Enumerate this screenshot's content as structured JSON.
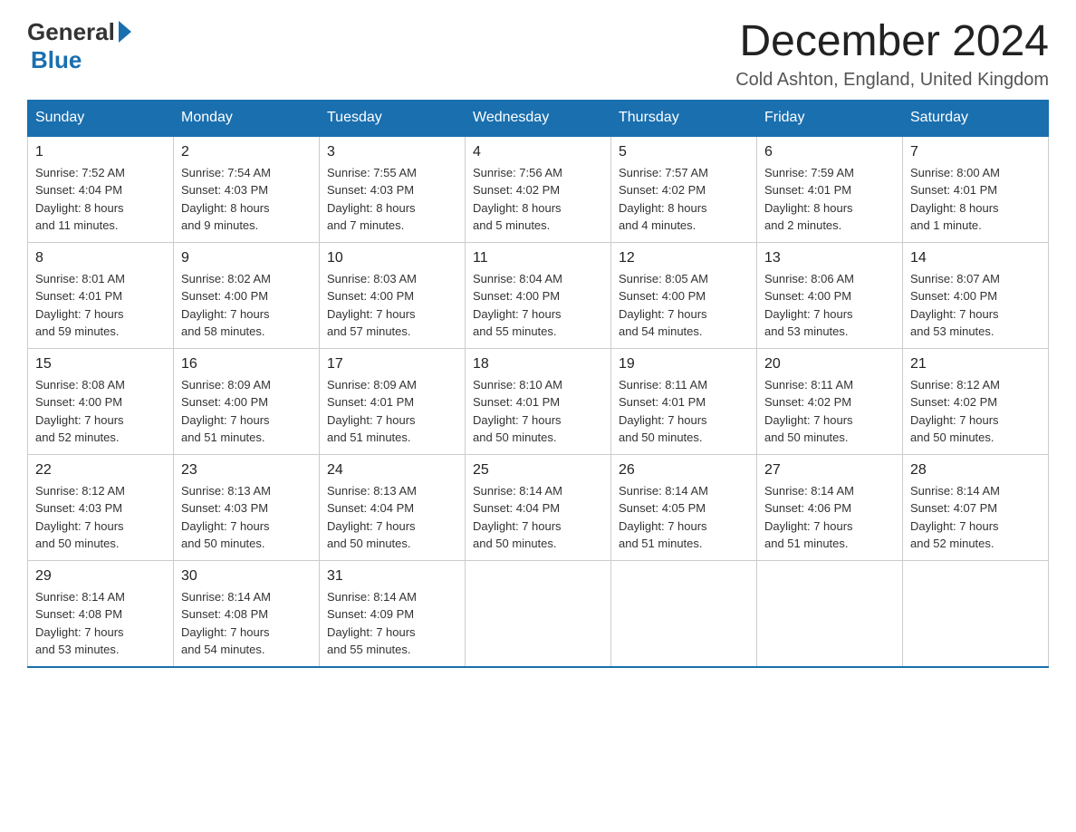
{
  "logo": {
    "text_general": "General",
    "text_blue": "Blue"
  },
  "title": "December 2024",
  "subtitle": "Cold Ashton, England, United Kingdom",
  "days_of_week": [
    "Sunday",
    "Monday",
    "Tuesday",
    "Wednesday",
    "Thursday",
    "Friday",
    "Saturday"
  ],
  "weeks": [
    [
      {
        "day": "1",
        "info": "Sunrise: 7:52 AM\nSunset: 4:04 PM\nDaylight: 8 hours\nand 11 minutes."
      },
      {
        "day": "2",
        "info": "Sunrise: 7:54 AM\nSunset: 4:03 PM\nDaylight: 8 hours\nand 9 minutes."
      },
      {
        "day": "3",
        "info": "Sunrise: 7:55 AM\nSunset: 4:03 PM\nDaylight: 8 hours\nand 7 minutes."
      },
      {
        "day": "4",
        "info": "Sunrise: 7:56 AM\nSunset: 4:02 PM\nDaylight: 8 hours\nand 5 minutes."
      },
      {
        "day": "5",
        "info": "Sunrise: 7:57 AM\nSunset: 4:02 PM\nDaylight: 8 hours\nand 4 minutes."
      },
      {
        "day": "6",
        "info": "Sunrise: 7:59 AM\nSunset: 4:01 PM\nDaylight: 8 hours\nand 2 minutes."
      },
      {
        "day": "7",
        "info": "Sunrise: 8:00 AM\nSunset: 4:01 PM\nDaylight: 8 hours\nand 1 minute."
      }
    ],
    [
      {
        "day": "8",
        "info": "Sunrise: 8:01 AM\nSunset: 4:01 PM\nDaylight: 7 hours\nand 59 minutes."
      },
      {
        "day": "9",
        "info": "Sunrise: 8:02 AM\nSunset: 4:00 PM\nDaylight: 7 hours\nand 58 minutes."
      },
      {
        "day": "10",
        "info": "Sunrise: 8:03 AM\nSunset: 4:00 PM\nDaylight: 7 hours\nand 57 minutes."
      },
      {
        "day": "11",
        "info": "Sunrise: 8:04 AM\nSunset: 4:00 PM\nDaylight: 7 hours\nand 55 minutes."
      },
      {
        "day": "12",
        "info": "Sunrise: 8:05 AM\nSunset: 4:00 PM\nDaylight: 7 hours\nand 54 minutes."
      },
      {
        "day": "13",
        "info": "Sunrise: 8:06 AM\nSunset: 4:00 PM\nDaylight: 7 hours\nand 53 minutes."
      },
      {
        "day": "14",
        "info": "Sunrise: 8:07 AM\nSunset: 4:00 PM\nDaylight: 7 hours\nand 53 minutes."
      }
    ],
    [
      {
        "day": "15",
        "info": "Sunrise: 8:08 AM\nSunset: 4:00 PM\nDaylight: 7 hours\nand 52 minutes."
      },
      {
        "day": "16",
        "info": "Sunrise: 8:09 AM\nSunset: 4:00 PM\nDaylight: 7 hours\nand 51 minutes."
      },
      {
        "day": "17",
        "info": "Sunrise: 8:09 AM\nSunset: 4:01 PM\nDaylight: 7 hours\nand 51 minutes."
      },
      {
        "day": "18",
        "info": "Sunrise: 8:10 AM\nSunset: 4:01 PM\nDaylight: 7 hours\nand 50 minutes."
      },
      {
        "day": "19",
        "info": "Sunrise: 8:11 AM\nSunset: 4:01 PM\nDaylight: 7 hours\nand 50 minutes."
      },
      {
        "day": "20",
        "info": "Sunrise: 8:11 AM\nSunset: 4:02 PM\nDaylight: 7 hours\nand 50 minutes."
      },
      {
        "day": "21",
        "info": "Sunrise: 8:12 AM\nSunset: 4:02 PM\nDaylight: 7 hours\nand 50 minutes."
      }
    ],
    [
      {
        "day": "22",
        "info": "Sunrise: 8:12 AM\nSunset: 4:03 PM\nDaylight: 7 hours\nand 50 minutes."
      },
      {
        "day": "23",
        "info": "Sunrise: 8:13 AM\nSunset: 4:03 PM\nDaylight: 7 hours\nand 50 minutes."
      },
      {
        "day": "24",
        "info": "Sunrise: 8:13 AM\nSunset: 4:04 PM\nDaylight: 7 hours\nand 50 minutes."
      },
      {
        "day": "25",
        "info": "Sunrise: 8:14 AM\nSunset: 4:04 PM\nDaylight: 7 hours\nand 50 minutes."
      },
      {
        "day": "26",
        "info": "Sunrise: 8:14 AM\nSunset: 4:05 PM\nDaylight: 7 hours\nand 51 minutes."
      },
      {
        "day": "27",
        "info": "Sunrise: 8:14 AM\nSunset: 4:06 PM\nDaylight: 7 hours\nand 51 minutes."
      },
      {
        "day": "28",
        "info": "Sunrise: 8:14 AM\nSunset: 4:07 PM\nDaylight: 7 hours\nand 52 minutes."
      }
    ],
    [
      {
        "day": "29",
        "info": "Sunrise: 8:14 AM\nSunset: 4:08 PM\nDaylight: 7 hours\nand 53 minutes."
      },
      {
        "day": "30",
        "info": "Sunrise: 8:14 AM\nSunset: 4:08 PM\nDaylight: 7 hours\nand 54 minutes."
      },
      {
        "day": "31",
        "info": "Sunrise: 8:14 AM\nSunset: 4:09 PM\nDaylight: 7 hours\nand 55 minutes."
      },
      {
        "day": "",
        "info": ""
      },
      {
        "day": "",
        "info": ""
      },
      {
        "day": "",
        "info": ""
      },
      {
        "day": "",
        "info": ""
      }
    ]
  ]
}
